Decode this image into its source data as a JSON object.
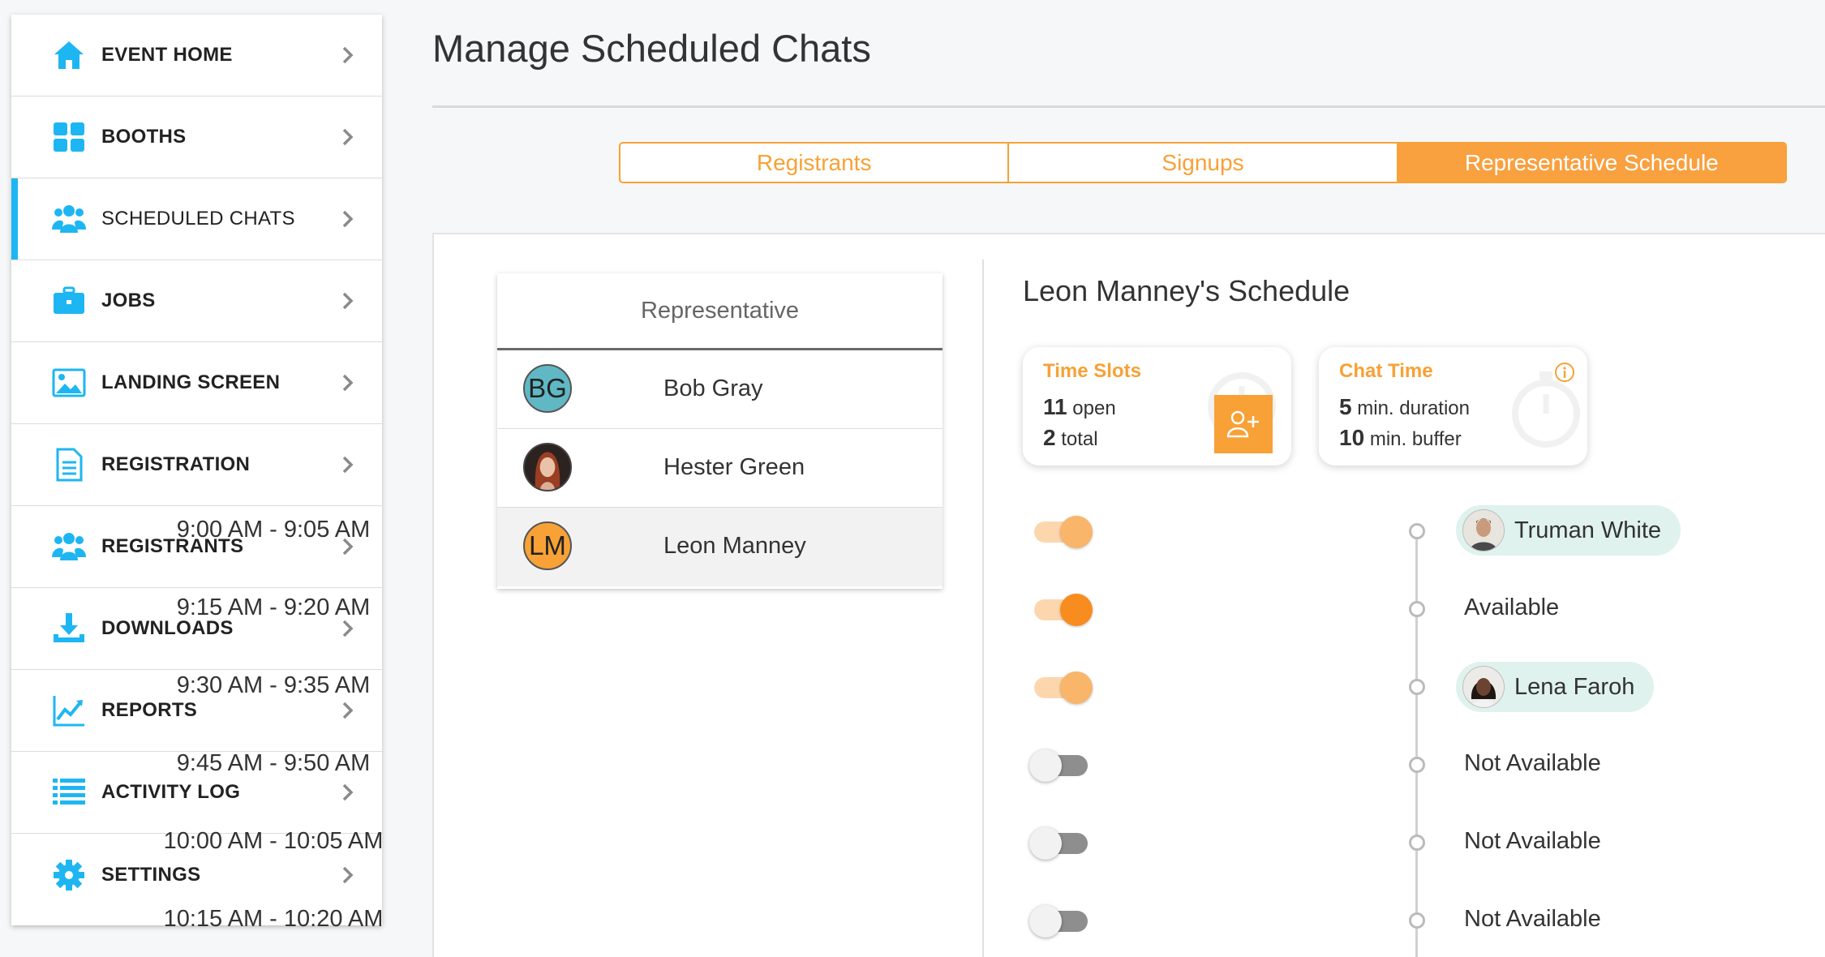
{
  "sidebar": {
    "items": [
      {
        "label": "EVENT HOME",
        "icon": "home-icon"
      },
      {
        "label": "BOOTHS",
        "icon": "grid-icon"
      },
      {
        "label": "SCHEDULED CHATS",
        "icon": "users-icon"
      },
      {
        "label": "JOBS",
        "icon": "briefcase-icon"
      },
      {
        "label": "LANDING SCREEN",
        "icon": "image-icon"
      },
      {
        "label": "REGISTRATION",
        "icon": "document-icon"
      },
      {
        "label": "REGISTRANTS",
        "icon": "users-icon"
      },
      {
        "label": "DOWNLOADS",
        "icon": "download-icon"
      },
      {
        "label": "REPORTS",
        "icon": "chart-icon"
      },
      {
        "label": "ACTIVITY LOG",
        "icon": "list-icon"
      },
      {
        "label": "SETTINGS",
        "icon": "gear-icon"
      }
    ],
    "active_index": 2,
    "accent_color": "#1eb6f2"
  },
  "header": {
    "title": "Manage Scheduled Chats"
  },
  "tabs": [
    {
      "label": "Registrants",
      "active": false
    },
    {
      "label": "Signups",
      "active": false
    },
    {
      "label": "Representative Schedule",
      "active": true
    }
  ],
  "accent_color": "#f7a136",
  "representatives": {
    "header": "Representative",
    "rows": [
      {
        "initials": "BG",
        "name": "Bob Gray",
        "avatar_color": "#5fb8c4"
      },
      {
        "initials": "",
        "name": "Hester Green",
        "avatar_color": "#7a3b2e"
      },
      {
        "initials": "LM",
        "name": "Leon Manney",
        "avatar_color": "#f7a136",
        "selected": true
      }
    ]
  },
  "schedule": {
    "title": "Leon Manney's Schedule",
    "time_slots": {
      "title": "Time Slots",
      "open_value": "11",
      "open_label": "open",
      "total_value": "2",
      "total_label": "total"
    },
    "chat_time": {
      "title": "Chat Time",
      "duration_value": "5",
      "duration_label": "min. duration",
      "buffer_value": "10",
      "buffer_label": "min. buffer"
    },
    "slots": [
      {
        "time": "9:00 AM - 9:05 AM",
        "enabled": true,
        "assignee": "Truman White",
        "type": "person"
      },
      {
        "time": "9:15 AM - 9:20 AM",
        "enabled": true,
        "assignee": "Available",
        "type": "text"
      },
      {
        "time": "9:30 AM - 9:35 AM",
        "enabled": true,
        "assignee": "Lena Faroh",
        "type": "person"
      },
      {
        "time": "9:45 AM - 9:50 AM",
        "enabled": false,
        "assignee": "Not Available",
        "type": "text"
      },
      {
        "time": "10:00 AM - 10:05 AM",
        "enabled": false,
        "assignee": "Not Available",
        "type": "text"
      },
      {
        "time": "10:15 AM - 10:20 AM",
        "enabled": false,
        "assignee": "Not Available",
        "type": "text"
      }
    ]
  }
}
